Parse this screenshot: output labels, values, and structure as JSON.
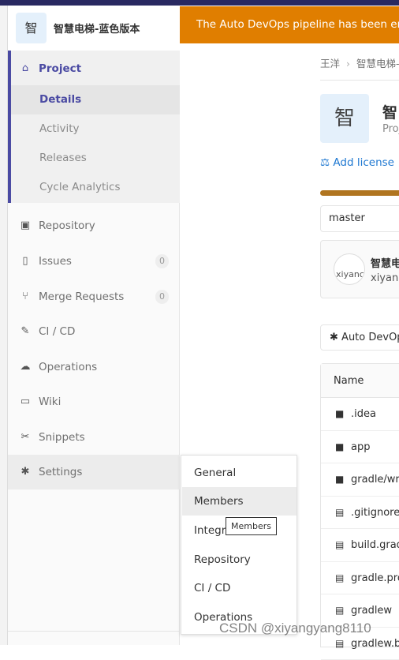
{
  "colors": {
    "topbar": "#292961",
    "banner": "#e07e00",
    "accent": "#4b4ba3",
    "link": "#1f78d1",
    "progress": "#b07520"
  },
  "sidebar": {
    "avatar_letter": "智",
    "project_name": "智慧电梯-蓝色版本",
    "project": {
      "label": "Project",
      "icon": "home-icon",
      "items": [
        {
          "label": "Details"
        },
        {
          "label": "Activity"
        },
        {
          "label": "Releases"
        },
        {
          "label": "Cycle Analytics"
        }
      ]
    },
    "items": [
      {
        "label": "Repository",
        "icon": "doc-icon"
      },
      {
        "label": "Issues",
        "icon": "issues-icon",
        "count": "0"
      },
      {
        "label": "Merge Requests",
        "icon": "merge-request-icon",
        "count": "0"
      },
      {
        "label": "CI / CD",
        "icon": "rocket-icon"
      },
      {
        "label": "Operations",
        "icon": "cloud-gear-icon"
      },
      {
        "label": "Wiki",
        "icon": "book-icon"
      },
      {
        "label": "Snippets",
        "icon": "scissors-icon"
      },
      {
        "label": "Settings",
        "icon": "gear-icon"
      }
    ]
  },
  "settings_menu": {
    "items": [
      {
        "label": "General"
      },
      {
        "label": "Members"
      },
      {
        "label": "Integra"
      },
      {
        "label": "Repository"
      },
      {
        "label": "CI / CD"
      },
      {
        "label": "Operations"
      }
    ],
    "tooltip": "Members"
  },
  "banner": {
    "text": "The Auto DevOps pipeline has been enabl"
  },
  "main": {
    "breadcrumb": [
      "王洋",
      "智慧电梯-蓝"
    ],
    "avatar_letter": "智",
    "title": "智",
    "subtitle": "Proj",
    "add_license": "Add license",
    "branch": "master",
    "commit": {
      "avatar_alt": "xiyanc",
      "title": "智慧电",
      "author": "xiyang"
    },
    "auto_devops_button": "Auto DevOp",
    "table": {
      "header": "Name",
      "rows": [
        {
          "name": ".idea",
          "type": "folder"
        },
        {
          "name": "app",
          "type": "folder"
        },
        {
          "name": "gradle/wra",
          "type": "folder"
        },
        {
          "name": ".gitignore",
          "type": "file"
        },
        {
          "name": "build.grad",
          "type": "file"
        },
        {
          "name": "gradle.pro",
          "type": "file"
        },
        {
          "name": "gradlew",
          "type": "file"
        },
        {
          "name": "gradlew.b",
          "type": "file"
        }
      ]
    }
  },
  "watermark": "CSDN @xiyangyang8110"
}
